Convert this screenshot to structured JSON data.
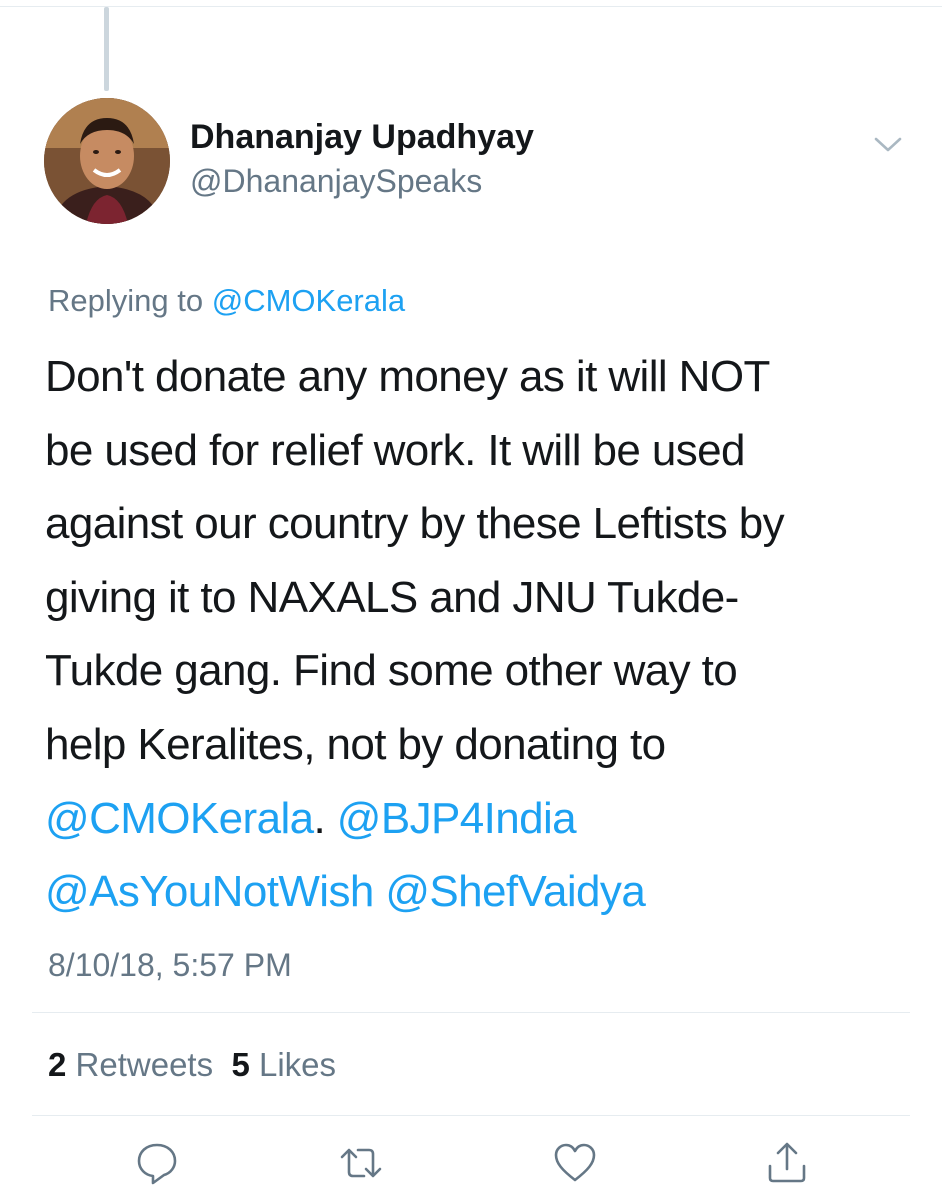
{
  "author": {
    "name": "Dhananjay Upadhyay",
    "handle": "@DhananjaySpeaks"
  },
  "reply": {
    "prefix": "Replying to ",
    "to": "@CMOKerala"
  },
  "tweet": {
    "lines": [
      "Don't donate any money as it will NOT",
      "be used for relief work. It will be used",
      "against our country by these Leftists by",
      "giving it to NAXALS and JNU Tukde-",
      "Tukde gang. Find some other way to",
      "help Keralites, not by donating to"
    ],
    "mentions": {
      "cmo": "@CMOKerala",
      "period": ".",
      "bjp": "@BJP4India",
      "asyou": "@AsYouNotWish",
      "shef": "@ShefVaidya"
    }
  },
  "timestamp": "8/10/18, 5:57 PM",
  "stats": {
    "retweets_count": "2",
    "retweets_label": "Retweets",
    "likes_count": "5",
    "likes_label": "Likes"
  },
  "icons": {
    "more": "chevron-down-icon",
    "reply": "reply-icon",
    "retweet": "retweet-icon",
    "like": "heart-icon",
    "share": "share-icon"
  },
  "colors": {
    "link": "#1da1f2",
    "secondary": "#657786",
    "primary": "#14171a",
    "icon": "#657786",
    "divider": "#e6ecf0"
  }
}
